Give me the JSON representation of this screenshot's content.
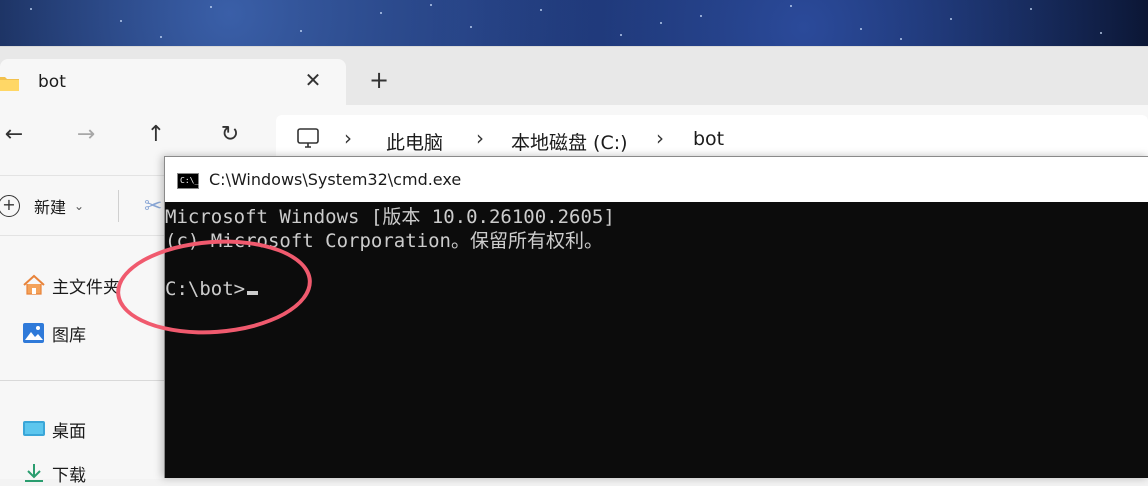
{
  "explorer": {
    "tab": {
      "title": "bot",
      "icon": "folder-icon"
    },
    "new_tab_icon": "plus-icon",
    "nav": {
      "back": "←",
      "forward": "→",
      "up": "↑",
      "refresh": "↻"
    },
    "breadcrumb": {
      "icon": "computer-icon",
      "items": [
        "此电脑",
        "本地磁盘 (C:)",
        "bot"
      ]
    },
    "command_bar": {
      "new_label": "新建"
    },
    "sidebar": {
      "items": [
        {
          "label": "主文件夹",
          "icon": "home-icon"
        },
        {
          "label": "图库",
          "icon": "gallery-icon"
        },
        {
          "label": "桌面",
          "icon": "desktop-icon"
        },
        {
          "label": "下载",
          "icon": "download-icon"
        }
      ]
    }
  },
  "cmd": {
    "title": "C:\\Windows\\System32\\cmd.exe",
    "icon_text": "C:\\_",
    "lines": [
      "Microsoft Windows [版本 10.0.26100.2605]",
      "(c) Microsoft Corporation。保留所有权利。",
      "",
      "C:\\bot>"
    ]
  },
  "colors": {
    "annotation": "#f05a6e",
    "console_bg": "#0c0c0c",
    "console_fg": "#cccccc"
  }
}
